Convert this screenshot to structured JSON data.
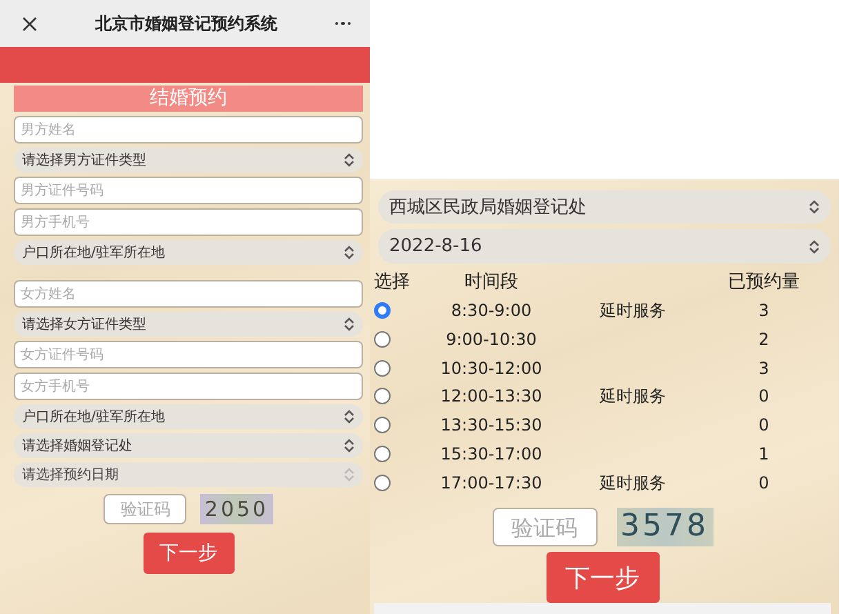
{
  "left": {
    "window": {
      "title": "北京市婚姻登记预约系统"
    },
    "banner_title": "结婚预约",
    "fields": [
      {
        "kind": "input",
        "placeholder": "男方姓名"
      },
      {
        "kind": "select",
        "value": "请选择男方证件类型",
        "disabled": false
      },
      {
        "kind": "input",
        "placeholder": "男方证件号码"
      },
      {
        "kind": "input",
        "placeholder": "男方手机号"
      },
      {
        "kind": "select",
        "value": "户口所在地/驻军所在地",
        "disabled": false
      },
      {
        "kind": "gap"
      },
      {
        "kind": "input",
        "placeholder": "女方姓名"
      },
      {
        "kind": "select",
        "value": "请选择女方证件类型",
        "disabled": false
      },
      {
        "kind": "input",
        "placeholder": "女方证件号码"
      },
      {
        "kind": "input",
        "placeholder": "女方手机号"
      },
      {
        "kind": "select",
        "value": "户口所在地/驻军所在地",
        "disabled": false
      },
      {
        "kind": "select",
        "value": "请选择婚姻登记处",
        "disabled": false
      },
      {
        "kind": "select",
        "value": "请选择预约日期",
        "disabled": true
      }
    ],
    "captcha": {
      "placeholder": "验证码",
      "code": "2050"
    },
    "next_button": "下一步"
  },
  "right": {
    "selects": [
      {
        "value": "西城区民政局婚姻登记处"
      },
      {
        "value": "2022-8-16"
      }
    ],
    "table": {
      "columns": [
        "选择",
        "时间段",
        "已预约量"
      ],
      "rows": [
        {
          "selected": true,
          "time": "8:30-9:00",
          "note": "延时服务",
          "count": "3"
        },
        {
          "selected": false,
          "time": "9:00-10:30",
          "count": "2"
        },
        {
          "selected": false,
          "time": "10:30-12:00",
          "count": "3"
        },
        {
          "selected": false,
          "time": "12:00-13:30",
          "note": "延时服务",
          "count": "0"
        },
        {
          "selected": false,
          "time": "13:30-15:30",
          "count": "0"
        },
        {
          "selected": false,
          "time": "15:30-17:00",
          "count": "1"
        },
        {
          "selected": false,
          "time": "17:00-17:30",
          "note": "延时服务",
          "count": "0"
        }
      ]
    },
    "captcha": {
      "placeholder": "验证码",
      "code": "3578"
    },
    "next_button": "下一步"
  }
}
